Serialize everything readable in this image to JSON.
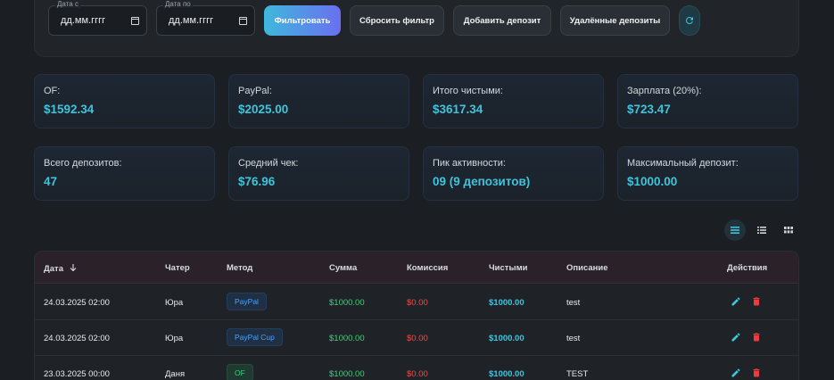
{
  "filters": {
    "date_from_label": "Дата с",
    "date_from_value": "дд.мм.гггг",
    "date_to_label": "Дата по",
    "date_to_value": "дд.мм.гггг",
    "filter_btn": "Фильтровать",
    "reset_btn": "Сбросить фильтр",
    "add_btn": "Добавить депозит",
    "deleted_btn": "Удалённые депозиты"
  },
  "stats": [
    {
      "label": "OF:",
      "value": "$1592.34"
    },
    {
      "label": "PayPal:",
      "value": "$2025.00"
    },
    {
      "label": "Итого чистыми:",
      "value": "$3617.34"
    },
    {
      "label": "Зарплата (20%):",
      "value": "$723.47"
    },
    {
      "label": "Всего депозитов:",
      "value": "47"
    },
    {
      "label": "Средний чек:",
      "value": "$76.96"
    },
    {
      "label": "Пик активности:",
      "value": "09 (9 депозитов)"
    },
    {
      "label": "Максимальный депозит:",
      "value": "$1000.00"
    }
  ],
  "table": {
    "headers": {
      "date": "Дата",
      "chatter": "Чатер",
      "method": "Метод",
      "amount": "Сумма",
      "fee": "Комиссия",
      "net": "Чистыми",
      "description": "Описание",
      "actions": "Действия"
    },
    "rows": [
      {
        "date": "24.03.2025 02:00",
        "chatter": "Юра",
        "method": "PayPal",
        "method_type": "paypal",
        "amount": "$1000.00",
        "fee": "$0.00",
        "net": "$1000.00",
        "description": "test"
      },
      {
        "date": "24.03.2025 02:00",
        "chatter": "Юра",
        "method": "PayPal Cup",
        "method_type": "paypal",
        "amount": "$1000.00",
        "fee": "$0.00",
        "net": "$1000.00",
        "description": "test"
      },
      {
        "date": "23.03.2025 00:00",
        "chatter": "Даня",
        "method": "OF",
        "method_type": "of",
        "amount": "$1000.00",
        "fee": "$0.00",
        "net": "$1000.00",
        "description": "TEST"
      }
    ]
  },
  "colors": {
    "accent": "#3fc4dc",
    "positive": "#3fcf7a",
    "negative": "#ef4a4a",
    "paypal": "#4aa3ff"
  }
}
